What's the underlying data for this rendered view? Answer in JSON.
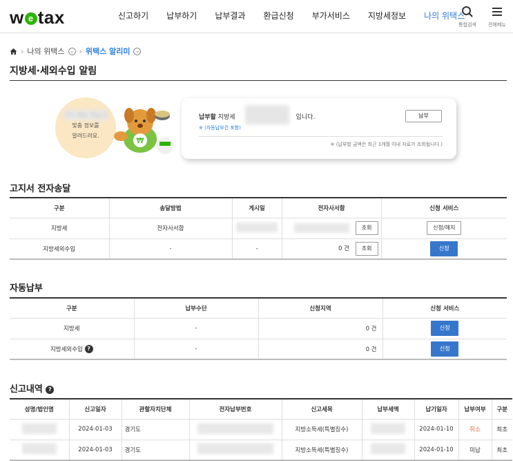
{
  "header": {
    "logo_pre": "w",
    "logo_mark": "e",
    "logo_post": "tax",
    "nav": [
      "신고하기",
      "납부하기",
      "납부결과",
      "환급신청",
      "부가서비스",
      "지방세정보",
      "나의 위택스"
    ],
    "search_caption": "통합검색",
    "menu_caption": "전체메뉴"
  },
  "breadcrumb": {
    "parent": "나의 위택스",
    "current": "위택스 알리미"
  },
  "page_title": "지방세·세외수입 알림",
  "alert": {
    "promo_line1": "고지, 체납, 환급 등",
    "promo_line2": "맞춤 정보를",
    "promo_line3": "알려드려요.",
    "line_pre": "납부할",
    "line_label": " 지방세",
    "line_suffix": "입니다.",
    "note1": "※ (자동납부건 포함)",
    "note2": "※ (납부할 금액은 최근 3개월 이내 자료가 조회됩니다.)",
    "pay_button": "납부"
  },
  "e_billing": {
    "title": "고지서 전자송달",
    "headers": [
      "구분",
      "송달방법",
      "게시일",
      "전자사서함",
      "신청 서비스"
    ],
    "rows": [
      {
        "type": "지방세",
        "method": "전자사서함",
        "date": "",
        "count": "",
        "view": "조회",
        "service": "신청/해지"
      },
      {
        "type": "지방세외수입",
        "method": "-",
        "date": "-",
        "count": "0 건",
        "view": "조회",
        "service": "신청"
      }
    ]
  },
  "auto_pay": {
    "title": "자동납부",
    "headers": [
      "구분",
      "납부수단",
      "신청지역",
      "신청 서비스"
    ],
    "rows": [
      {
        "type": "지방세",
        "means": "-",
        "region": "0 건",
        "service": "신청"
      },
      {
        "type": "지방세외수입",
        "means": "-",
        "region": "0 건",
        "service": "신청"
      }
    ]
  },
  "reports": {
    "title": "신고내역",
    "headers": [
      "성명/법인명",
      "신고일자",
      "관할자치단체",
      "전자납부번호",
      "신고세목",
      "납부세액",
      "납기일자",
      "납부여부",
      "구분"
    ],
    "rows": [
      {
        "date": "2024-01-03",
        "gov": "경기도",
        "item": "지방소득세(특별징수)",
        "due": "2024-01-10",
        "status": "취소",
        "kind": "최초"
      },
      {
        "date": "2024-01-03",
        "gov": "경기도",
        "item": "지방소득세(특별징수)",
        "due": "2024-01-10",
        "status": "미납",
        "kind": "최초"
      }
    ]
  },
  "colors": {
    "accent": "#2d7de0",
    "button_blue": "#3677cc",
    "cancel": "#e06a3a",
    "logo_green": "#2db400"
  }
}
